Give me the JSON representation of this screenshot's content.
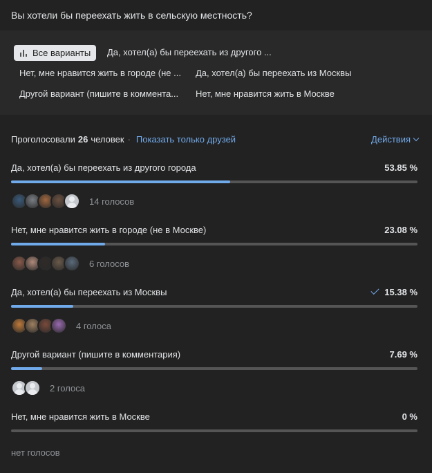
{
  "poll": {
    "question": "Вы хотели бы переехать жить в сельскую местность?"
  },
  "filters": {
    "all_label": "Все варианты",
    "options": [
      "Да, хотел(а) бы переехать из другого ...",
      "Нет, мне нравится жить в городе (не ...",
      "Да, хотел(а) бы переехать из Москвы",
      "Другой вариант (пишите в коммента...",
      "Нет, мне нравится жить в Москве"
    ]
  },
  "summary": {
    "prefix": "Проголосовали",
    "count": "26",
    "suffix": "человек",
    "separator": "·",
    "friends_link": "Показать только друзей",
    "actions_label": "Действия"
  },
  "answers": [
    {
      "text": "Да, хотел(а) бы переехать из другого города",
      "percent_label": "53.85 %",
      "percent": 53.85,
      "votes_label": "14 голосов",
      "voted": false,
      "avatars": [
        "#3a5a7a",
        "#7a7f85",
        "#a0673f",
        "#6b5040",
        "placeholder"
      ]
    },
    {
      "text": "Нет, мне нравится жить в городе (не в Москве)",
      "percent_label": "23.08 %",
      "percent": 23.08,
      "votes_label": "6 голосов",
      "voted": false,
      "avatars": [
        "#8a5a4a",
        "#b08a7a",
        "#2e2a28",
        "#6a5a4a",
        "#5a6a7a"
      ]
    },
    {
      "text": "Да, хотел(а) бы переехать из Москвы",
      "percent_label": "15.38 %",
      "percent": 15.38,
      "votes_label": "4 голоса",
      "voted": true,
      "avatars": [
        "#c07a3a",
        "#a08060",
        "#7a4a3a",
        "#9a6ab0"
      ]
    },
    {
      "text": "Другой вариант (пишите в комментария)",
      "percent_label": "7.69 %",
      "percent": 7.69,
      "votes_label": "2 голоса",
      "voted": false,
      "avatars": [
        "placeholder",
        "placeholder"
      ]
    },
    {
      "text": "Нет, мне нравится жить в Москве",
      "percent_label": "0 %",
      "percent": 0,
      "votes_label": "нет голосов",
      "voted": false,
      "avatars": []
    }
  ],
  "colors": {
    "background": "#222222",
    "panel": "#292929",
    "accent": "#71aaeb",
    "track": "#555555",
    "muted_text": "#909499"
  }
}
